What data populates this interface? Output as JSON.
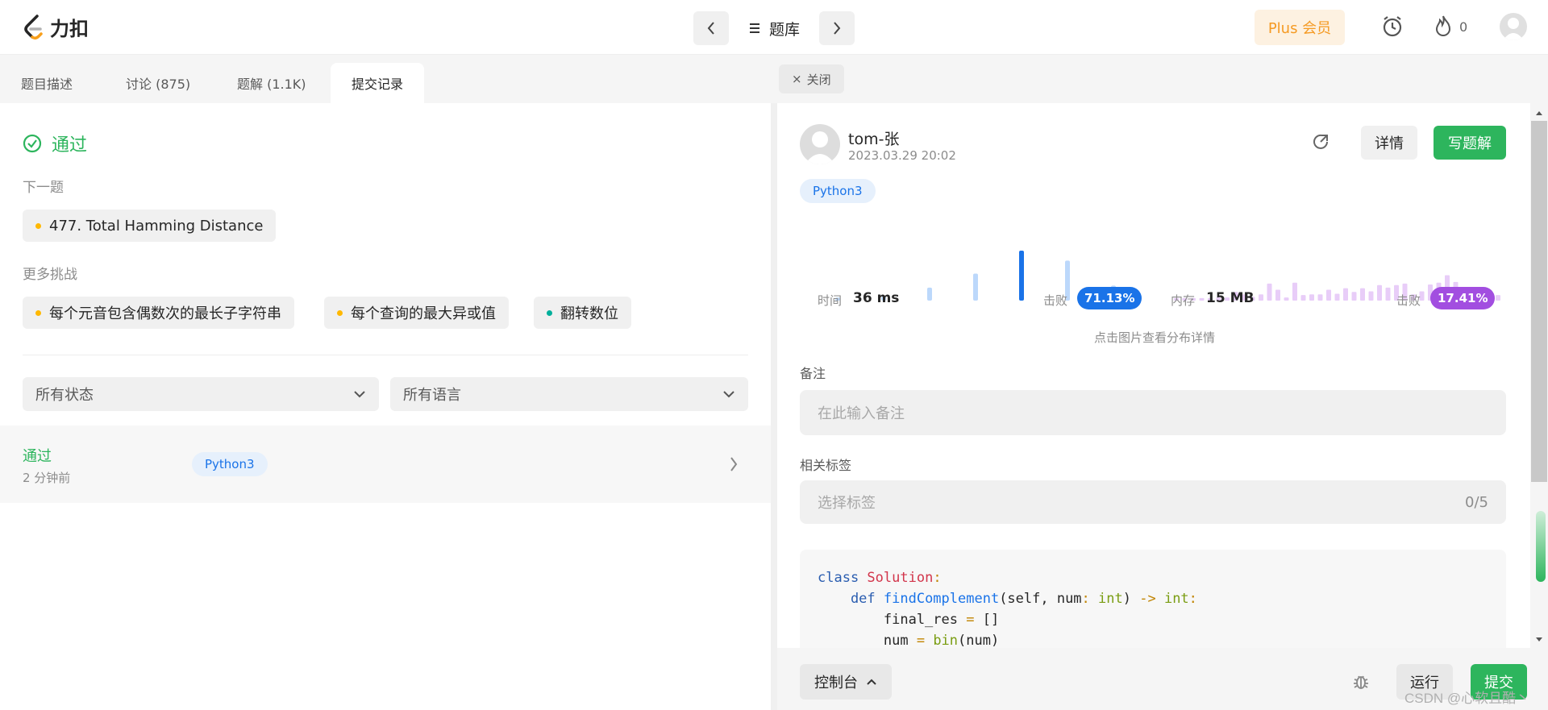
{
  "brand": {
    "name": "力扣",
    "logo_icon": "leetcode-logo-icon"
  },
  "header": {
    "problemset_label": "题库",
    "plus_label": "Plus 会员",
    "streak_count": "0",
    "colors": {
      "plus_bg": "#fdf1e1",
      "plus_text": "#f59a23"
    }
  },
  "tabs": [
    {
      "label": "题目描述"
    },
    {
      "label": "讨论 (875)"
    },
    {
      "label": "题解 (1.1K)"
    },
    {
      "label": "提交记录"
    }
  ],
  "left": {
    "status": "通过",
    "next_label": "下一题",
    "next_problem": "477. Total Hamming Distance",
    "more_label": "更多挑战",
    "challenges": [
      {
        "label": "每个元音包含偶数次的最长子字符串",
        "color": "#ffb800"
      },
      {
        "label": "每个查询的最大异或值",
        "color": "#ffb800"
      },
      {
        "label": "翻转数位",
        "color": "#00af9b"
      }
    ],
    "filter_status": "所有状态",
    "filter_lang": "所有语言",
    "submission": {
      "status": "通过",
      "time": "2 分钟前",
      "lang": "Python3"
    }
  },
  "right": {
    "close_label": "关闭",
    "user": "tom-张",
    "datetime": "2023.03.29 20:02",
    "detail_label": "详情",
    "write_label": "写题解",
    "lang": "Python3",
    "runtime": {
      "label": "时间",
      "value": "36 ms",
      "beat_label": "击败",
      "beat": "71.13%"
    },
    "memory": {
      "label": "内存",
      "value": "15 MB",
      "beat_label": "击败",
      "beat": "17.41%"
    },
    "hint": "点击图片查看分布详情",
    "note_label": "备注",
    "note_placeholder": "在此输入备注",
    "tags_label": "相关标签",
    "tags_placeholder": "选择标签",
    "tags_count": "0/5",
    "runtime_bars": [
      0.06,
      0.08,
      0.26,
      0.54,
      1.0,
      0.8,
      0.3
    ],
    "memory_bars": [
      0.08,
      0.08,
      0.08,
      0.08,
      0.08,
      0.1,
      0.1,
      0.28,
      0.2,
      0.12,
      0.2,
      0.55,
      0.35,
      0.1,
      0.58,
      0.18,
      0.2,
      0.2,
      0.35,
      0.22,
      0.4,
      0.28,
      0.4,
      0.3,
      0.5,
      0.42,
      0.5,
      0.55,
      0.2,
      0.3,
      0.52,
      0.58,
      0.82,
      0.6,
      0.38,
      0.22,
      0.1,
      0.22,
      0.18
    ]
  },
  "code_lines": [
    [
      {
        "t": "class ",
        "c": "kw"
      },
      {
        "t": "Solution",
        "c": "cls"
      },
      {
        "t": ":",
        "c": "op"
      }
    ],
    [
      {
        "t": "    def ",
        "c": "kw"
      },
      {
        "t": "findComplement",
        "c": "fn"
      },
      {
        "t": "(self, num",
        "c": ""
      },
      {
        "t": ": ",
        "c": "op"
      },
      {
        "t": "int",
        "c": "bi"
      },
      {
        "t": ") ",
        "c": ""
      },
      {
        "t": "-> ",
        "c": "op"
      },
      {
        "t": "int",
        "c": "bi"
      },
      {
        "t": ":",
        "c": "op"
      }
    ],
    [
      {
        "t": "        final_res ",
        "c": ""
      },
      {
        "t": "= ",
        "c": "op"
      },
      {
        "t": "[]",
        "c": ""
      }
    ],
    [
      {
        "t": "        num ",
        "c": ""
      },
      {
        "t": "= ",
        "c": "op"
      },
      {
        "t": "bin",
        "c": "bi"
      },
      {
        "t": "(num)",
        "c": ""
      }
    ]
  ],
  "bottom": {
    "console_label": "控制台",
    "run_label": "运行",
    "submit_label": "提交"
  },
  "watermark": "CSDN @心软且酷丶"
}
